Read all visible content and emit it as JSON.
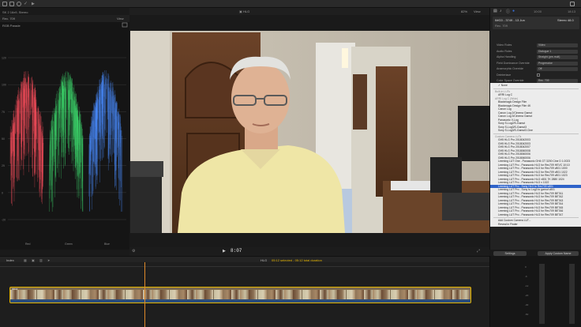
{
  "app": {
    "library_name": "SK 2 16x9, Stereo",
    "colors": {
      "accent_yellow": "#e4b400",
      "selection_blue": "#2f63c9",
      "playhead": "#e08a2a"
    }
  },
  "toolbar": {
    "icons": [
      "library-icon",
      "import-icon",
      "keyword-icon",
      "checkmark-icon"
    ],
    "share_icon": "share-icon"
  },
  "viewer": {
    "format": "Rec. 709",
    "view_menu": "View",
    "resolution": "HLG",
    "zoom": "82%",
    "view_menu_right": "View",
    "timecode": "8:07",
    "frame_rate": "HLG",
    "selection_info": "05:12 selected - 05:12 total duration"
  },
  "scopes": {
    "title": "RGB Parade",
    "labels": [
      "Red",
      "Green",
      "Blue"
    ],
    "scale": [
      "120",
      "100",
      "75",
      "50",
      "25",
      "0",
      "-20"
    ],
    "colors": [
      "#ff4f5f",
      "#3ee070",
      "#4a8cff"
    ]
  },
  "inspector": {
    "header_time": "10:00",
    "header_duration": "18:13",
    "clip_title": "IMG3 - 3749 - 13 Jun",
    "clip_right": "Stereo 48.0",
    "clip_format": "Rec. 709",
    "rows": [
      {
        "label": "Video Roles",
        "value": "Video",
        "type": "select"
      },
      {
        "label": "Audio Roles",
        "value": "Dialogue 1",
        "type": "select"
      },
      {
        "label": "Alpha Handling",
        "value": "Straight (pre-mult)",
        "type": "select"
      },
      {
        "label": "Field Dominance Override",
        "value": "Progressive",
        "type": "select"
      },
      {
        "label": "Anamorphic Override",
        "value": "Off",
        "type": "select"
      },
      {
        "label": "Deinterlace",
        "value": "",
        "type": "check"
      },
      {
        "label": "Color Space Override",
        "value": "Rec. 709",
        "type": "select"
      },
      {
        "label": "Camera LUT",
        "value": "None",
        "type": "select"
      }
    ],
    "lut_menu": [
      {
        "text": "None",
        "kind": "item"
      },
      {
        "text": "",
        "kind": "sep"
      },
      {
        "text": "Built-in LUTs",
        "kind": "head"
      },
      {
        "text": "ARRI Log C",
        "kind": "item"
      },
      {
        "text": "ARRI Log C (Wide)",
        "kind": "head"
      },
      {
        "text": "Blackmagic Design Film",
        "kind": "item"
      },
      {
        "text": "Blackmagic Design Film 4K",
        "kind": "item"
      },
      {
        "text": "Canon Log",
        "kind": "item"
      },
      {
        "text": "Canon Log 2/Cinema Gamut",
        "kind": "item"
      },
      {
        "text": "Canon Log 3/Cinema Gamut",
        "kind": "item"
      },
      {
        "text": "Panasonic V-Log",
        "kind": "item"
      },
      {
        "text": "Sony S-Log2/S-Gamut",
        "kind": "item"
      },
      {
        "text": "Sony S-Log3/S-Gamut3",
        "kind": "item"
      },
      {
        "text": "Sony S-Log3/S-Gamut3.Cine",
        "kind": "item"
      },
      {
        "text": "",
        "kind": "sep"
      },
      {
        "text": "Custom Camera LUTs",
        "kind": "head"
      },
      {
        "text": "GH5 HLG Pro 2018042003",
        "kind": "item"
      },
      {
        "text": "GH5 HLG Pro 2018042003",
        "kind": "item"
      },
      {
        "text": "GH5 HLG Pro 2018042007",
        "kind": "item"
      },
      {
        "text": "GH5 HLG Pro 2018060008",
        "kind": "item"
      },
      {
        "text": "GH5 HLG Pro 2018060006",
        "kind": "item"
      },
      {
        "text": "GH5 HLG Pro 2018060006",
        "kind": "item"
      },
      {
        "text": "Leeming LUT One - Panasonic GH4 GT 3200 Cine D 1.0023",
        "kind": "item"
      },
      {
        "text": "Leeming LUT Pro - Panasonic HLG for Rec709 HEVC 10:10",
        "kind": "item"
      },
      {
        "text": "Leeming LUT Pro - Panasonic HLG for Rec709 v801 1000",
        "kind": "item"
      },
      {
        "text": "Leeming LUT Pro - Panasonic HLG for Rec709 v801 1022",
        "kind": "item"
      },
      {
        "text": "Leeming LUT Pro - Panasonic HLG for Rec709 v801 1023",
        "kind": "item"
      },
      {
        "text": "Leeming LUT Pro - Panasonic HLG v801 7K 2880 1024",
        "kind": "item"
      },
      {
        "text": "Leeming LUT Pro - Panasonic HLG v 1022",
        "kind": "item"
      },
      {
        "text": "Leeming LUT Pro - Sony HLG to Rec709 v801",
        "kind": "item",
        "selected": true
      },
      {
        "text": "Leeming LUT Pro - Sony to Log3 to gamut v801",
        "kind": "item"
      },
      {
        "text": "Leeming LUT Pro - Panasonic HLG for Rec709 BETA1",
        "kind": "item"
      },
      {
        "text": "Leeming LUT Pro - Panasonic HLG for Rec709 BETA2",
        "kind": "item"
      },
      {
        "text": "Leeming LUT Pro - Panasonic HLG for Rec709 BETA3",
        "kind": "item"
      },
      {
        "text": "Leeming LUT Pro - Panasonic HLG for Rec709 BETA4",
        "kind": "item"
      },
      {
        "text": "Leeming LUT Pro - Panasonic HLG for Rec709 BETA5",
        "kind": "item"
      },
      {
        "text": "Leeming LUT Pro - Panasonic HLG for Rec709 BETA6",
        "kind": "item"
      },
      {
        "text": "Leeming LUT Pro - Panasonic HLG for Rec709 BETA7",
        "kind": "item"
      },
      {
        "text": "",
        "kind": "sep"
      },
      {
        "text": "Add Custom Camera LUT...",
        "kind": "item"
      },
      {
        "text": "Reveal in Finder",
        "kind": "item"
      }
    ],
    "settings_button": "Settings",
    "apply_button": "Apply Custom Name"
  },
  "timeline": {
    "index_label": "Index",
    "clip_label": "IMG3",
    "meter_scale": [
      "0",
      "-6",
      "-12",
      "-20",
      "-30",
      "-50"
    ]
  }
}
